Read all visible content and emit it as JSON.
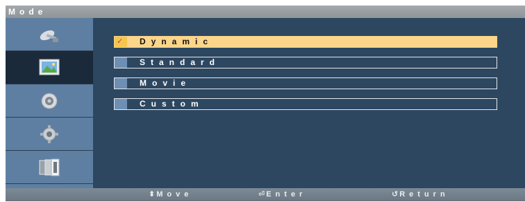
{
  "title": "Mode",
  "sidebar": {
    "items": [
      {
        "icon": "satellite-dish-icon",
        "active": false
      },
      {
        "icon": "picture-icon",
        "active": true
      },
      {
        "icon": "speaker-icon",
        "active": false
      },
      {
        "icon": "gear-icon",
        "active": false
      },
      {
        "icon": "input-source-icon",
        "active": false
      }
    ]
  },
  "menu": {
    "items": [
      {
        "label": "Dynamic",
        "selected": true,
        "check": "✓"
      },
      {
        "label": "Standard",
        "selected": false
      },
      {
        "label": "Movie",
        "selected": false
      },
      {
        "label": "Custom",
        "selected": false
      }
    ]
  },
  "footer": {
    "move": {
      "glyph": "⬍",
      "label": "Move"
    },
    "enter": {
      "glyph": "⏎",
      "label": "Enter"
    },
    "return": {
      "glyph": "↺",
      "label": "Return"
    }
  },
  "colors": {
    "panel": "#2d4761",
    "sidebar": "#5e7fa2",
    "selected_row": "#fbd58a",
    "title_bar": "#9a9fa3"
  }
}
